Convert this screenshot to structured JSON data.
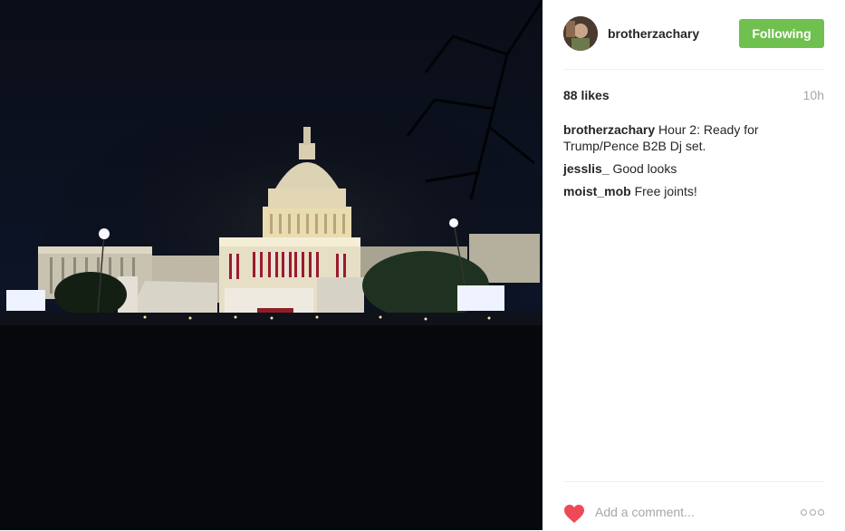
{
  "post": {
    "username": "brotherzachary",
    "follow_label": "Following",
    "likes": "88 likes",
    "timestamp": "10h",
    "comments": [
      {
        "user": "brotherzachary",
        "text": "Hour 2: Ready for Trump/Pence B2B Dj set."
      },
      {
        "user": "jesslis_",
        "text": "Good looks"
      },
      {
        "user": "moist_mob",
        "text": "Free joints!"
      }
    ],
    "comment_placeholder": "Add a comment..."
  },
  "colors": {
    "follow_button": "#70c050",
    "heart": "#ed4956",
    "muted_text": "#a5a7aa",
    "photo_background": "#05070c"
  },
  "icons": {
    "like": "heart-icon",
    "more_options": "more-options-icon"
  }
}
